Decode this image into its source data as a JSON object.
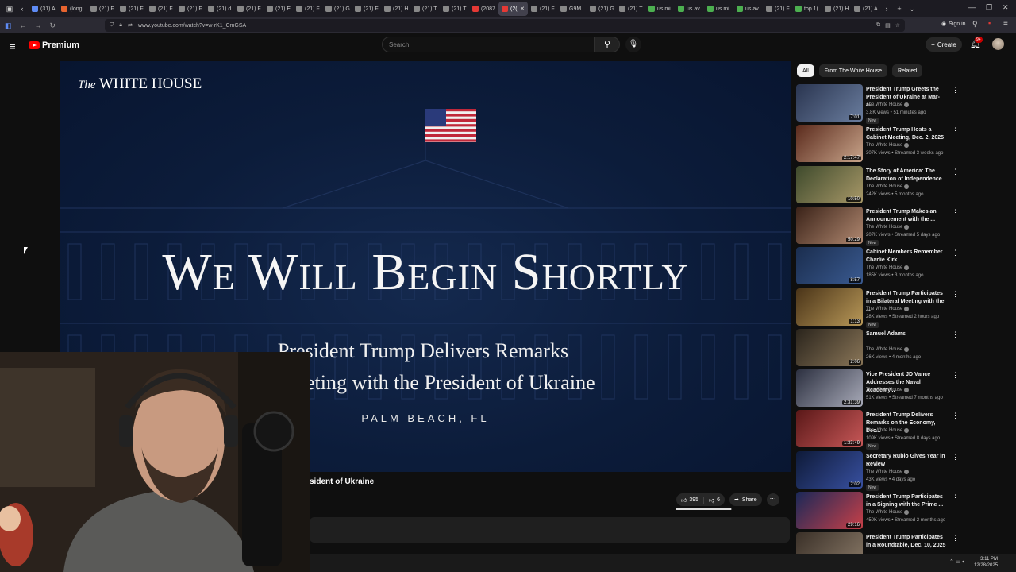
{
  "browser": {
    "tabs": [
      {
        "label": "(31) A",
        "color": "#5e8bf5"
      },
      {
        "label": "(long",
        "color": "#e8642f"
      },
      {
        "label": "(21) F",
        "color": "#888888"
      },
      {
        "label": "(21) F",
        "color": "#888888"
      },
      {
        "label": "(21) F",
        "color": "#888888"
      },
      {
        "label": "(21) F",
        "color": "#888888"
      },
      {
        "label": "(21) d",
        "color": "#888888"
      },
      {
        "label": "(21) F",
        "color": "#888888"
      },
      {
        "label": "(21) E",
        "color": "#888888"
      },
      {
        "label": "(21) F",
        "color": "#888888"
      },
      {
        "label": "(21) G",
        "color": "#888888"
      },
      {
        "label": "(21) F",
        "color": "#888888"
      },
      {
        "label": "(21) H",
        "color": "#888888"
      },
      {
        "label": "(21) T",
        "color": "#888888"
      },
      {
        "label": "(21) T",
        "color": "#888888"
      },
      {
        "label": "(2087",
        "color": "#e53935"
      },
      {
        "label": "(2(",
        "color": "#e53935",
        "active": true
      },
      {
        "label": "(21) F",
        "color": "#888888"
      },
      {
        "label": "G9M",
        "color": "#888888"
      },
      {
        "label": "(21) G",
        "color": "#888888"
      },
      {
        "label": "(21) T",
        "color": "#888888"
      },
      {
        "label": "us mi",
        "color": "#4caf50"
      },
      {
        "label": "us av",
        "color": "#4caf50"
      },
      {
        "label": "us mi",
        "color": "#4caf50"
      },
      {
        "label": "us av",
        "color": "#4caf50"
      },
      {
        "label": "(21) F",
        "color": "#888888"
      },
      {
        "label": "top 1(",
        "color": "#4caf50"
      },
      {
        "label": "(21) H",
        "color": "#888888"
      },
      {
        "label": "(21) A",
        "color": "#888888"
      }
    ],
    "url": "www.youtube.com/watch?v=w-rK1_CmGSA",
    "signin_label": "Sign in"
  },
  "youtube": {
    "logo_text": "Premium",
    "search_placeholder": "Search",
    "create_label": "Create",
    "notif_badge": "9+"
  },
  "video": {
    "wh_logo_the": "The",
    "wh_logo_rest": "WHITE HOUSE",
    "headline": "We Will Begin Shortly",
    "sub1": "President Trump Delivers Remarks",
    "sub2": "ral Meeting with the President of Ukraine",
    "location": "PALM BEACH, FL",
    "title_visible": "sident of Ukraine",
    "likes": "395",
    "dislikes": "6",
    "share_label": "Share",
    "like_ratio": 0.985
  },
  "chips": [
    "All",
    "From The White House",
    "Related"
  ],
  "recommendations": [
    {
      "title": "President Trump Greets the President of Ukraine at Mar-a-...",
      "channel": "The White House",
      "meta": "3.8K views • 51 minutes ago",
      "badge": "New",
      "duration": "7:01",
      "c1": "#2a3550",
      "c2": "#6a7d9e"
    },
    {
      "title": "President Trump Hosts a Cabinet Meeting, Dec. 2, 2025",
      "channel": "The White House",
      "meta": "307K views • Streamed 3 weeks ago",
      "badge": "",
      "duration": "2:17:47",
      "c1": "#5a2a1c",
      "c2": "#c8a48a"
    },
    {
      "title": "The Story of America: The Declaration of Independence",
      "channel": "The White House",
      "meta": "242K views • 5 months ago",
      "badge": "",
      "duration": "10:50",
      "c1": "#3e4a2c",
      "c2": "#a89868"
    },
    {
      "title": "President Trump Makes an Announcement with the ...",
      "channel": "The White House",
      "meta": "207K views • Streamed 5 days ago",
      "badge": "New",
      "duration": "50:29",
      "c1": "#3a2218",
      "c2": "#b08870"
    },
    {
      "title": "Cabinet Members Remember Charlie Kirk",
      "channel": "The White House",
      "meta": "185K views • 3 months ago",
      "badge": "",
      "duration": "8:57",
      "c1": "#1a2d4e",
      "c2": "#3a5a90"
    },
    {
      "title": "President Trump Participates in a Bilateral Meeting with the ...",
      "channel": "The White House",
      "meta": "28K views • Streamed 2 hours ago",
      "badge": "New",
      "duration": "1:13",
      "c1": "#4a3418",
      "c2": "#b89858"
    },
    {
      "title": "Samuel Adams",
      "channel": "The White House",
      "meta": "26K views • 4 months ago",
      "badge": "",
      "duration": "2:06",
      "c1": "#2a241c",
      "c2": "#8a7658"
    },
    {
      "title": "Vice President JD Vance Addresses the Naval Academy...",
      "channel": "The White House",
      "meta": "51K views • Streamed 7 months ago",
      "badge": "",
      "duration": "2:31:39",
      "c1": "#2c3040",
      "c2": "#a8aab8"
    },
    {
      "title": "President Trump Delivers Remarks on the Economy, Dec...",
      "channel": "The White House",
      "meta": "109K views • Streamed 8 days ago",
      "badge": "New",
      "duration": "1:33:49",
      "c1": "#5a1818",
      "c2": "#c85858"
    },
    {
      "title": "Secretary Rubio Gives Year in Review",
      "channel": "The White House",
      "meta": "43K views • 4 days ago",
      "badge": "New",
      "duration": "2:02",
      "c1": "#0e1a38",
      "c2": "#3850a0"
    },
    {
      "title": "President Trump Participates in a Signing with the Prime ...",
      "channel": "The White House",
      "meta": "450K views • Streamed 2 months ago",
      "badge": "",
      "duration": "29:16",
      "c1": "#1a2858",
      "c2": "#c84048"
    },
    {
      "title": "President Trump Participates in a Roundtable, Dec. 10, 2025",
      "channel": "",
      "meta": "",
      "badge": "",
      "duration": "",
      "c1": "#3a3028",
      "c2": "#8a7a68"
    }
  ],
  "taskbar": {
    "time": "3:11 PM",
    "date": "12/28/2025"
  }
}
